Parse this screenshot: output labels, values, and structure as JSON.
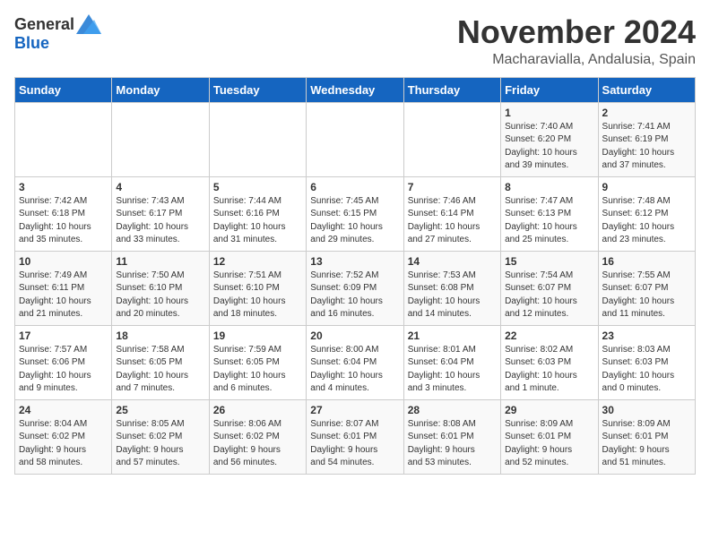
{
  "logo": {
    "text_general": "General",
    "text_blue": "Blue"
  },
  "header": {
    "month_title": "November 2024",
    "location": "Macharavialla, Andalusia, Spain"
  },
  "weekdays": [
    "Sunday",
    "Monday",
    "Tuesday",
    "Wednesday",
    "Thursday",
    "Friday",
    "Saturday"
  ],
  "weeks": [
    [
      {
        "day": "",
        "info": ""
      },
      {
        "day": "",
        "info": ""
      },
      {
        "day": "",
        "info": ""
      },
      {
        "day": "",
        "info": ""
      },
      {
        "day": "",
        "info": ""
      },
      {
        "day": "1",
        "info": "Sunrise: 7:40 AM\nSunset: 6:20 PM\nDaylight: 10 hours\nand 39 minutes."
      },
      {
        "day": "2",
        "info": "Sunrise: 7:41 AM\nSunset: 6:19 PM\nDaylight: 10 hours\nand 37 minutes."
      }
    ],
    [
      {
        "day": "3",
        "info": "Sunrise: 7:42 AM\nSunset: 6:18 PM\nDaylight: 10 hours\nand 35 minutes."
      },
      {
        "day": "4",
        "info": "Sunrise: 7:43 AM\nSunset: 6:17 PM\nDaylight: 10 hours\nand 33 minutes."
      },
      {
        "day": "5",
        "info": "Sunrise: 7:44 AM\nSunset: 6:16 PM\nDaylight: 10 hours\nand 31 minutes."
      },
      {
        "day": "6",
        "info": "Sunrise: 7:45 AM\nSunset: 6:15 PM\nDaylight: 10 hours\nand 29 minutes."
      },
      {
        "day": "7",
        "info": "Sunrise: 7:46 AM\nSunset: 6:14 PM\nDaylight: 10 hours\nand 27 minutes."
      },
      {
        "day": "8",
        "info": "Sunrise: 7:47 AM\nSunset: 6:13 PM\nDaylight: 10 hours\nand 25 minutes."
      },
      {
        "day": "9",
        "info": "Sunrise: 7:48 AM\nSunset: 6:12 PM\nDaylight: 10 hours\nand 23 minutes."
      }
    ],
    [
      {
        "day": "10",
        "info": "Sunrise: 7:49 AM\nSunset: 6:11 PM\nDaylight: 10 hours\nand 21 minutes."
      },
      {
        "day": "11",
        "info": "Sunrise: 7:50 AM\nSunset: 6:10 PM\nDaylight: 10 hours\nand 20 minutes."
      },
      {
        "day": "12",
        "info": "Sunrise: 7:51 AM\nSunset: 6:10 PM\nDaylight: 10 hours\nand 18 minutes."
      },
      {
        "day": "13",
        "info": "Sunrise: 7:52 AM\nSunset: 6:09 PM\nDaylight: 10 hours\nand 16 minutes."
      },
      {
        "day": "14",
        "info": "Sunrise: 7:53 AM\nSunset: 6:08 PM\nDaylight: 10 hours\nand 14 minutes."
      },
      {
        "day": "15",
        "info": "Sunrise: 7:54 AM\nSunset: 6:07 PM\nDaylight: 10 hours\nand 12 minutes."
      },
      {
        "day": "16",
        "info": "Sunrise: 7:55 AM\nSunset: 6:07 PM\nDaylight: 10 hours\nand 11 minutes."
      }
    ],
    [
      {
        "day": "17",
        "info": "Sunrise: 7:57 AM\nSunset: 6:06 PM\nDaylight: 10 hours\nand 9 minutes."
      },
      {
        "day": "18",
        "info": "Sunrise: 7:58 AM\nSunset: 6:05 PM\nDaylight: 10 hours\nand 7 minutes."
      },
      {
        "day": "19",
        "info": "Sunrise: 7:59 AM\nSunset: 6:05 PM\nDaylight: 10 hours\nand 6 minutes."
      },
      {
        "day": "20",
        "info": "Sunrise: 8:00 AM\nSunset: 6:04 PM\nDaylight: 10 hours\nand 4 minutes."
      },
      {
        "day": "21",
        "info": "Sunrise: 8:01 AM\nSunset: 6:04 PM\nDaylight: 10 hours\nand 3 minutes."
      },
      {
        "day": "22",
        "info": "Sunrise: 8:02 AM\nSunset: 6:03 PM\nDaylight: 10 hours\nand 1 minute."
      },
      {
        "day": "23",
        "info": "Sunrise: 8:03 AM\nSunset: 6:03 PM\nDaylight: 10 hours\nand 0 minutes."
      }
    ],
    [
      {
        "day": "24",
        "info": "Sunrise: 8:04 AM\nSunset: 6:02 PM\nDaylight: 9 hours\nand 58 minutes."
      },
      {
        "day": "25",
        "info": "Sunrise: 8:05 AM\nSunset: 6:02 PM\nDaylight: 9 hours\nand 57 minutes."
      },
      {
        "day": "26",
        "info": "Sunrise: 8:06 AM\nSunset: 6:02 PM\nDaylight: 9 hours\nand 56 minutes."
      },
      {
        "day": "27",
        "info": "Sunrise: 8:07 AM\nSunset: 6:01 PM\nDaylight: 9 hours\nand 54 minutes."
      },
      {
        "day": "28",
        "info": "Sunrise: 8:08 AM\nSunset: 6:01 PM\nDaylight: 9 hours\nand 53 minutes."
      },
      {
        "day": "29",
        "info": "Sunrise: 8:09 AM\nSunset: 6:01 PM\nDaylight: 9 hours\nand 52 minutes."
      },
      {
        "day": "30",
        "info": "Sunrise: 8:09 AM\nSunset: 6:01 PM\nDaylight: 9 hours\nand 51 minutes."
      }
    ]
  ]
}
